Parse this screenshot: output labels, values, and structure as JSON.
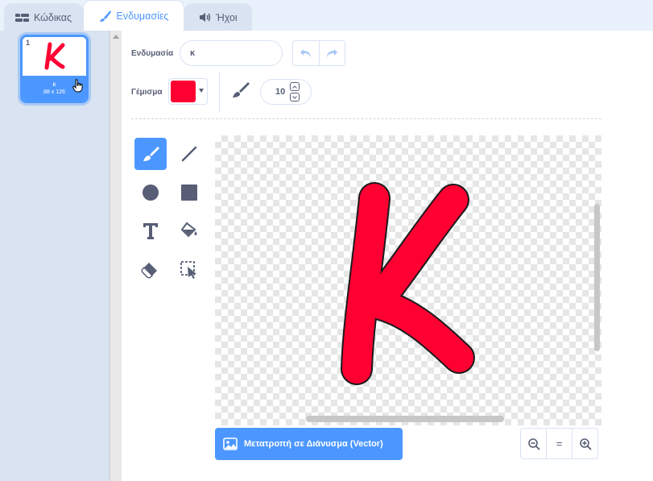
{
  "tabs": [
    {
      "label": "Κώδικας",
      "icon": "code-icon",
      "active": false
    },
    {
      "label": "Ενδυμασίες",
      "icon": "brush-icon",
      "active": true
    },
    {
      "label": "Ήχοι",
      "icon": "speaker-icon",
      "active": false
    }
  ],
  "costumes": [
    {
      "number": "1",
      "name": "κ",
      "size": "88 x 126",
      "selected": true
    }
  ],
  "toolbar": {
    "costume_label": "Ενδυμασία",
    "costume_name": "κ",
    "fill_label": "Γέμισμα",
    "fill_color": "#ff0033",
    "brush_size": "10"
  },
  "tools": [
    {
      "name": "brush-tool",
      "icon": "brush-icon",
      "active": true
    },
    {
      "name": "line-tool",
      "icon": "line-icon",
      "active": false
    },
    {
      "name": "circle-tool",
      "icon": "circle-icon",
      "active": false
    },
    {
      "name": "rectangle-tool",
      "icon": "rectangle-icon",
      "active": false
    },
    {
      "name": "text-tool",
      "icon": "text-icon",
      "active": false
    },
    {
      "name": "fill-tool",
      "icon": "paint-bucket-icon",
      "active": false
    },
    {
      "name": "eraser-tool",
      "icon": "eraser-icon",
      "active": false
    },
    {
      "name": "select-tool",
      "icon": "select-icon",
      "active": false
    }
  ],
  "canvas": {
    "glyph": "κ",
    "glyph_color": "#ff0033"
  },
  "convert_button": {
    "label": "Μετατροπή σε Διάνυσμα (Vector)"
  },
  "zoom": {
    "out": "−",
    "reset": "=",
    "in": "+"
  },
  "colors": {
    "accent": "#4c97ff",
    "tab_bg": "#d9e3f2",
    "text": "#575e75"
  }
}
